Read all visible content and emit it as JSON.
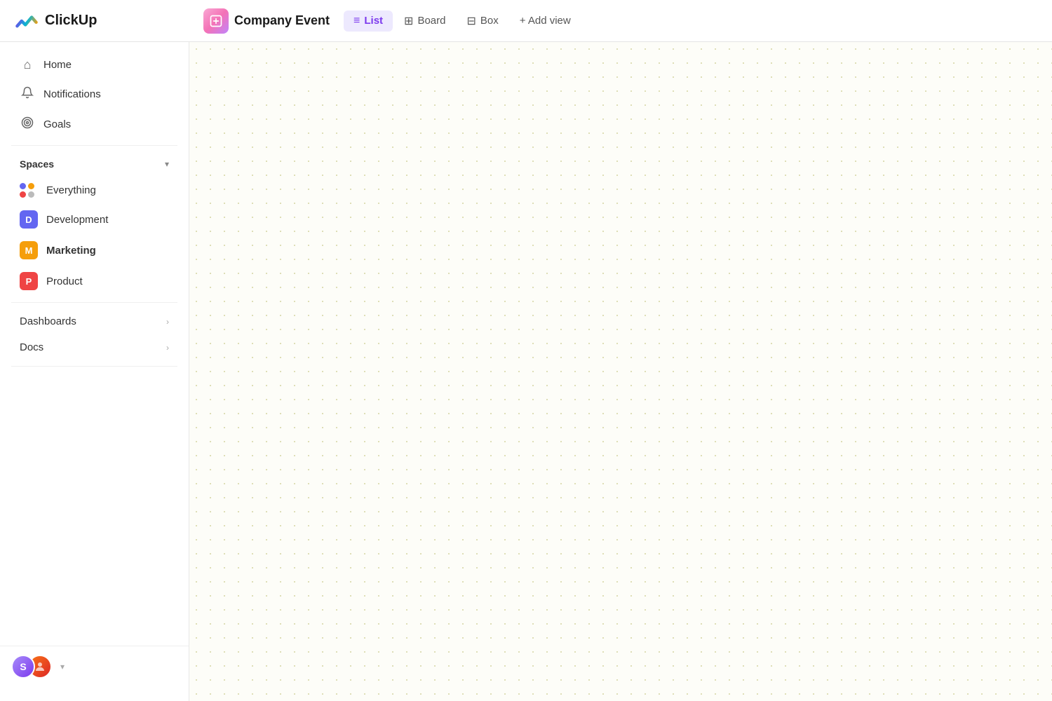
{
  "app": {
    "name": "ClickUp"
  },
  "header": {
    "project_name": "Company Event",
    "views": [
      {
        "id": "list",
        "label": "List",
        "icon": "☰",
        "active": true
      },
      {
        "id": "board",
        "label": "Board",
        "icon": "⊞",
        "active": false
      },
      {
        "id": "box",
        "label": "Box",
        "icon": "⊟",
        "active": false
      }
    ],
    "add_view_label": "+ Add view"
  },
  "sidebar": {
    "nav": [
      {
        "id": "home",
        "label": "Home",
        "icon": "⌂"
      },
      {
        "id": "notifications",
        "label": "Notifications",
        "icon": "🔔"
      },
      {
        "id": "goals",
        "label": "Goals",
        "icon": "🏆"
      }
    ],
    "spaces_label": "Spaces",
    "spaces": [
      {
        "id": "everything",
        "label": "Everything",
        "type": "everything"
      },
      {
        "id": "development",
        "label": "Development",
        "type": "dev",
        "letter": "D"
      },
      {
        "id": "marketing",
        "label": "Marketing",
        "type": "mkt",
        "letter": "M",
        "active": true
      },
      {
        "id": "product",
        "label": "Product",
        "type": "prd",
        "letter": "P"
      }
    ],
    "sections": [
      {
        "id": "dashboards",
        "label": "Dashboards"
      },
      {
        "id": "docs",
        "label": "Docs"
      }
    ],
    "user_avatar_letter": "S"
  }
}
